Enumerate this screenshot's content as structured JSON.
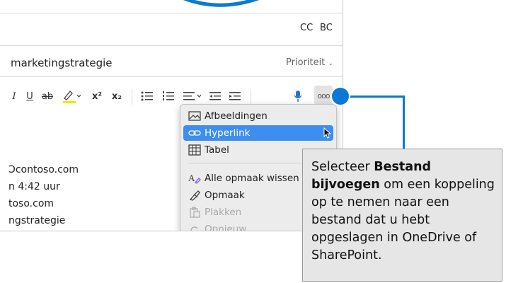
{
  "header": {
    "cc_label": "CC",
    "bcc_label": "BC"
  },
  "subject": {
    "value": "marketingstrategie",
    "priority_label": "Prioriteit"
  },
  "toolbar": {
    "italic": "I",
    "underline": "U",
    "strike": "ab",
    "superscript": "x²",
    "subscript": "x₂",
    "more": "ooo"
  },
  "body_lines": [
    "Ɔcontoso.com",
    "n 4:42 uur",
    "toso.com",
    "ngstrategie"
  ],
  "menu": {
    "items": [
      {
        "label": "Afbeeldingen",
        "icon": "image-icon",
        "state": "normal"
      },
      {
        "label": "Hyperlink",
        "icon": "link-icon",
        "state": "active"
      },
      {
        "label": "Tabel",
        "icon": "table-icon",
        "state": "normal"
      },
      {
        "label": "Alle opmaak wissen",
        "icon": "clear-format-icon",
        "state": "normal"
      },
      {
        "label": "Opmaak",
        "icon": "format-painter-icon",
        "state": "normal"
      },
      {
        "label": "Plakken",
        "icon": "paste-icon",
        "state": "disabled"
      },
      {
        "label": "Opnieuw",
        "icon": "redo-icon",
        "state": "disabled"
      }
    ]
  },
  "callout": {
    "text_1": "Selecteer ",
    "bold": "Bestand bijvoegen",
    "text_2": " om een koppeling op te nemen naar een bestand dat u hebt opgeslagen in OneDrive of SharePoint."
  },
  "colors": {
    "accent": "#0a78d4",
    "menu_highlight": "#3d8ef0",
    "callout_bg": "#e6e6e6"
  }
}
